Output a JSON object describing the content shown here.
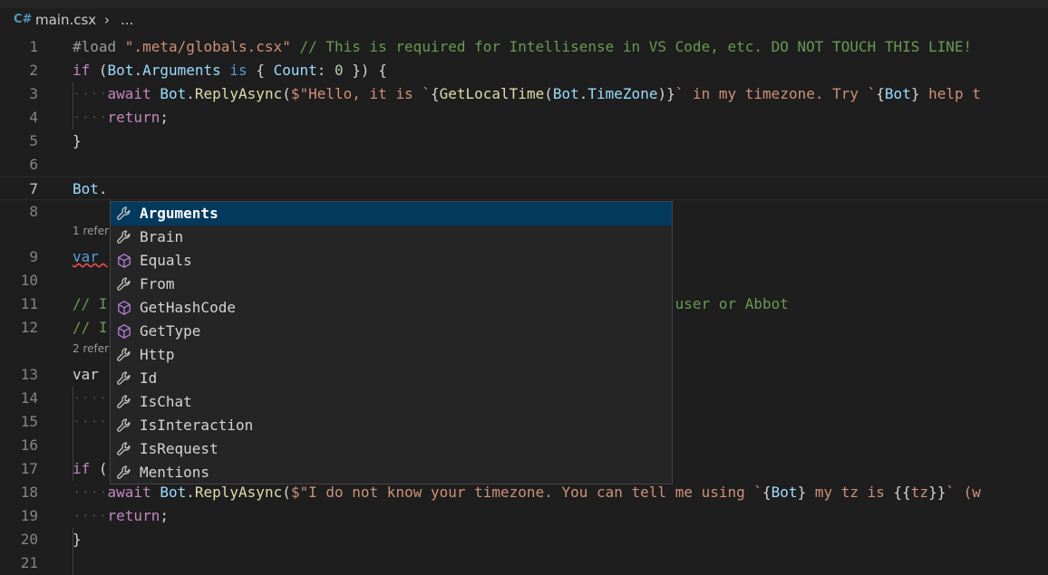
{
  "breadcrumb": {
    "icon": "C#",
    "file": "main.csx",
    "separator": "›",
    "more": "..."
  },
  "codelens": [
    "1 refer",
    "2 refer"
  ],
  "lines": [
    {
      "n": "1",
      "tokens": [
        [
          "dir",
          "#load "
        ],
        [
          "str",
          "\".meta/globals.csx\" "
        ],
        [
          "cm",
          "// This is required for Intellisense in VS Code, etc. DO NOT TOUCH THIS LINE!"
        ]
      ]
    },
    {
      "n": "2",
      "tokens": [
        [
          "ctl",
          "if "
        ],
        [
          "pl",
          "("
        ],
        [
          "var",
          "Bot"
        ],
        [
          "pl",
          "."
        ],
        [
          "var",
          "Arguments "
        ],
        [
          "kw",
          "is "
        ],
        [
          "pl",
          "{ "
        ],
        [
          "var",
          "Count"
        ],
        [
          "pl",
          ": "
        ],
        [
          "num",
          "0 "
        ],
        [
          "pl",
          "}) {"
        ]
      ]
    },
    {
      "n": "3",
      "indent": "····",
      "tokens": [
        [
          "ctl",
          "await "
        ],
        [
          "var",
          "Bot"
        ],
        [
          "pl",
          "."
        ],
        [
          "fn",
          "ReplyAsync"
        ],
        [
          "pl",
          "("
        ],
        [
          "str",
          "$\"Hello, it is `"
        ],
        [
          "pl",
          "{"
        ],
        [
          "fn",
          "GetLocalTime"
        ],
        [
          "pl",
          "("
        ],
        [
          "var",
          "Bot"
        ],
        [
          "pl",
          "."
        ],
        [
          "var",
          "TimeZone"
        ],
        [
          "pl",
          ")}"
        ],
        [
          "str",
          "` in my timezone. Try `"
        ],
        [
          "pl",
          "{"
        ],
        [
          "var",
          "Bot"
        ],
        [
          "pl",
          "}"
        ],
        [
          "str",
          " help t"
        ]
      ]
    },
    {
      "n": "4",
      "indent": "····",
      "tokens": [
        [
          "ctl",
          "return"
        ],
        [
          "pl",
          ";"
        ]
      ]
    },
    {
      "n": "5",
      "tokens": [
        [
          "pl",
          "}"
        ]
      ]
    },
    {
      "n": "6",
      "tokens": []
    },
    {
      "n": "7",
      "tokens": [
        [
          "var",
          "Bot"
        ],
        [
          "pl",
          "."
        ]
      ]
    },
    {
      "n": "8",
      "tokens": []
    },
    {
      "n": "9",
      "tokens": [
        [
          "kw",
          "var "
        ]
      ]
    },
    {
      "n": "10",
      "tokens": []
    },
    {
      "n": "11",
      "tokens": [
        [
          "cm",
          "// I                                                                 user or Abbot"
        ]
      ]
    },
    {
      "n": "12",
      "tokens": [
        [
          "cm",
          "// I"
        ]
      ]
    },
    {
      "n": "13",
      "tokens": [
        [
          "kw",
          "var "
        ]
      ]
    },
    {
      "n": "14",
      "indent": "····",
      "tokens": []
    },
    {
      "n": "15",
      "indent": "····",
      "tokens": []
    },
    {
      "n": "16",
      "tokens": []
    },
    {
      "n": "17",
      "tokens": [
        [
          "ctl",
          "if "
        ],
        [
          "pl",
          "("
        ]
      ]
    },
    {
      "n": "18",
      "indent": "····",
      "tokens": [
        [
          "ctl",
          "await "
        ],
        [
          "var",
          "Bot"
        ],
        [
          "pl",
          "."
        ],
        [
          "fn",
          "ReplyAsync"
        ],
        [
          "pl",
          "("
        ],
        [
          "str",
          "$\"I do not know your timezone. You can tell me using `"
        ],
        [
          "pl",
          "{"
        ],
        [
          "var",
          "Bot"
        ],
        [
          "pl",
          "}"
        ],
        [
          "str",
          " my tz is "
        ],
        [
          "pl",
          "{{"
        ],
        [
          "str",
          "tz"
        ],
        [
          "pl",
          "}}"
        ],
        [
          "str",
          "` (w"
        ]
      ]
    },
    {
      "n": "19",
      "indent": "····",
      "tokens": [
        [
          "ctl",
          "return"
        ],
        [
          "pl",
          ";"
        ]
      ]
    },
    {
      "n": "20",
      "tokens": [
        [
          "pl",
          "}"
        ]
      ]
    },
    {
      "n": "21",
      "tokens": []
    }
  ],
  "suggestions": [
    {
      "label": "Arguments",
      "kind": "property",
      "icon": "wrench-icon",
      "selected": true
    },
    {
      "label": "Brain",
      "kind": "property",
      "icon": "wrench-icon"
    },
    {
      "label": "Equals",
      "kind": "method",
      "icon": "cube-icon"
    },
    {
      "label": "From",
      "kind": "property",
      "icon": "wrench-icon"
    },
    {
      "label": "GetHashCode",
      "kind": "method",
      "icon": "cube-icon"
    },
    {
      "label": "GetType",
      "kind": "method",
      "icon": "cube-icon"
    },
    {
      "label": "Http",
      "kind": "property",
      "icon": "wrench-icon"
    },
    {
      "label": "Id",
      "kind": "property",
      "icon": "wrench-icon"
    },
    {
      "label": "IsChat",
      "kind": "property",
      "icon": "wrench-icon"
    },
    {
      "label": "IsInteraction",
      "kind": "property",
      "icon": "wrench-icon"
    },
    {
      "label": "IsRequest",
      "kind": "property",
      "icon": "wrench-icon"
    },
    {
      "label": "Mentions",
      "kind": "property",
      "icon": "wrench-icon"
    }
  ],
  "colors": {
    "background": "#1e1e1e",
    "selection": "#04395e",
    "method_icon": "#b180d7"
  }
}
